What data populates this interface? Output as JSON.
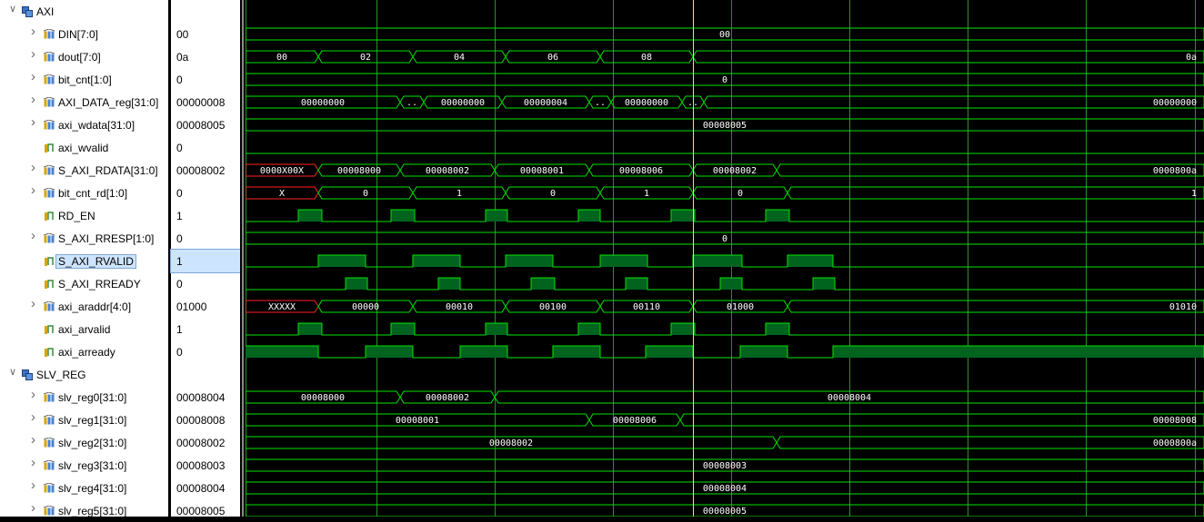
{
  "colors": {
    "bus_green": "#00e400",
    "x_red": "#ff2222",
    "fill_green": "#00641e",
    "grid": "#2c8f2c",
    "cursor": "#f4f400",
    "selected_bg": "#cde4ff"
  },
  "icons": {
    "expand": "chevron-right",
    "group": "group-folder-icon",
    "bus": "bus-signal-icon",
    "bit": "bit-signal-icon"
  },
  "signals": [
    {
      "name": "AXI",
      "value": "",
      "kind": "group",
      "expander": "down",
      "indent": 0
    },
    {
      "name": "DIN[7:0]",
      "value": "00",
      "kind": "bus",
      "expander": "right",
      "indent": 1,
      "segments": [
        {
          "t0": 0,
          "t1": 1054,
          "label": "00"
        }
      ]
    },
    {
      "name": "dout[7:0]",
      "value": "0a",
      "kind": "bus",
      "expander": "right",
      "indent": 1,
      "segments": [
        {
          "t0": 0,
          "t1": 80,
          "label": "00"
        },
        {
          "t0": 80,
          "t1": 184,
          "label": "02"
        },
        {
          "t0": 184,
          "t1": 286,
          "label": "04"
        },
        {
          "t0": 286,
          "t1": 390,
          "label": "06"
        },
        {
          "t0": 390,
          "t1": 492,
          "label": "08"
        },
        {
          "t0": 492,
          "t1": 1054,
          "label": "0a",
          "align": "right"
        }
      ]
    },
    {
      "name": "bit_cnt[1:0]",
      "value": "0",
      "kind": "bus",
      "expander": "right",
      "indent": 1,
      "segments": [
        {
          "t0": 0,
          "t1": 1054,
          "label": "0"
        }
      ]
    },
    {
      "name": "AXI_DATA_reg[31:0]",
      "value": "00000008",
      "kind": "bus",
      "expander": "right",
      "indent": 1,
      "segments": [
        {
          "t0": 0,
          "t1": 170,
          "label": "00000000"
        },
        {
          "t0": 170,
          "t1": 196,
          "label": ".."
        },
        {
          "t0": 196,
          "t1": 282,
          "label": "00000000"
        },
        {
          "t0": 282,
          "t1": 378,
          "label": "00000004"
        },
        {
          "t0": 378,
          "t1": 402,
          "label": ".."
        },
        {
          "t0": 402,
          "t1": 480,
          "label": "00000000"
        },
        {
          "t0": 480,
          "t1": 504,
          "label": ".."
        },
        {
          "t0": 504,
          "t1": 1054,
          "label": "00000000",
          "align": "right"
        }
      ]
    },
    {
      "name": "axi_wdata[31:0]",
      "value": "00008005",
      "kind": "bus",
      "expander": "right",
      "indent": 1,
      "segments": [
        {
          "t0": 0,
          "t1": 1054,
          "label": "00008005"
        }
      ]
    },
    {
      "name": "axi_wvalid",
      "value": "0",
      "kind": "bit",
      "expander": "none",
      "indent": 1,
      "edges": [
        0
      ]
    },
    {
      "name": "S_AXI_RDATA[31:0]",
      "value": "00008002",
      "kind": "bus",
      "expander": "right",
      "indent": 1,
      "segments": [
        {
          "t0": 0,
          "t1": 80,
          "label": "0000X00X",
          "x": true
        },
        {
          "t0": 80,
          "t1": 170,
          "label": "00008000"
        },
        {
          "t0": 170,
          "t1": 274,
          "label": "00008002"
        },
        {
          "t0": 274,
          "t1": 378,
          "label": "00008001"
        },
        {
          "t0": 378,
          "t1": 492,
          "label": "00008006"
        },
        {
          "t0": 492,
          "t1": 584,
          "label": "00008002"
        },
        {
          "t0": 584,
          "t1": 1054,
          "label": "0000800a",
          "align": "right"
        }
      ]
    },
    {
      "name": "bit_cnt_rd[1:0]",
      "value": "0",
      "kind": "bus",
      "expander": "right",
      "indent": 1,
      "segments": [
        {
          "t0": 0,
          "t1": 80,
          "label": "X",
          "x": true
        },
        {
          "t0": 80,
          "t1": 184,
          "label": "0"
        },
        {
          "t0": 184,
          "t1": 286,
          "label": "1"
        },
        {
          "t0": 286,
          "t1": 390,
          "label": "0"
        },
        {
          "t0": 390,
          "t1": 492,
          "label": "1"
        },
        {
          "t0": 492,
          "t1": 596,
          "label": "0"
        },
        {
          "t0": 596,
          "t1": 1054,
          "label": "1",
          "align": "right"
        }
      ]
    },
    {
      "name": "RD_EN",
      "value": "1",
      "kind": "bit",
      "expander": "none",
      "indent": 1,
      "edges": [
        0,
        58,
        84,
        160,
        186,
        264,
        288,
        366,
        390,
        468,
        494,
        572,
        598
      ]
    },
    {
      "name": "S_AXI_RRESP[1:0]",
      "value": "0",
      "kind": "bus",
      "expander": "right",
      "indent": 1,
      "segments": [
        {
          "t0": 0,
          "t1": 1054,
          "label": "0"
        }
      ]
    },
    {
      "name": "S_AXI_RVALID",
      "value": "1",
      "kind": "bit",
      "expander": "none",
      "indent": 1,
      "selected": true,
      "edges": [
        0,
        80,
        132,
        184,
        236,
        286,
        338,
        390,
        442,
        492,
        546,
        596,
        646
      ]
    },
    {
      "name": "S_AXI_RREADY",
      "value": "0",
      "kind": "bit",
      "expander": "none",
      "indent": 1,
      "edges": [
        0,
        110,
        134,
        212,
        236,
        314,
        340,
        418,
        442,
        522,
        546,
        624,
        648
      ]
    },
    {
      "name": "axi_araddr[4:0]",
      "value": "01000",
      "kind": "bus",
      "expander": "right",
      "indent": 1,
      "segments": [
        {
          "t0": 0,
          "t1": 80,
          "label": "XXXXX",
          "x": true
        },
        {
          "t0": 80,
          "t1": 184,
          "label": "00000"
        },
        {
          "t0": 184,
          "t1": 286,
          "label": "00010"
        },
        {
          "t0": 286,
          "t1": 390,
          "label": "00100"
        },
        {
          "t0": 390,
          "t1": 492,
          "label": "00110"
        },
        {
          "t0": 492,
          "t1": 596,
          "label": "01000"
        },
        {
          "t0": 596,
          "t1": 1054,
          "label": "01010",
          "align": "right"
        }
      ]
    },
    {
      "name": "axi_arvalid",
      "value": "1",
      "kind": "bit",
      "expander": "none",
      "indent": 1,
      "edges": [
        0,
        58,
        84,
        160,
        186,
        264,
        288,
        366,
        390,
        468,
        494,
        572,
        598
      ]
    },
    {
      "name": "axi_arready",
      "value": "0",
      "kind": "bit",
      "expander": "none",
      "indent": 1,
      "startHigh": true,
      "edges": [
        0,
        80,
        132,
        184,
        236,
        288,
        338,
        390,
        440,
        492,
        544,
        596,
        646,
        1054
      ]
    },
    {
      "name": "SLV_REG",
      "value": "",
      "kind": "group",
      "expander": "down",
      "indent": 0
    },
    {
      "name": "slv_reg0[31:0]",
      "value": "00008004",
      "kind": "bus",
      "expander": "right",
      "indent": 1,
      "segments": [
        {
          "t0": 0,
          "t1": 170,
          "label": "00008000"
        },
        {
          "t0": 170,
          "t1": 274,
          "label": "00008002"
        },
        {
          "t0": 274,
          "t1": 1054,
          "label": "00008004"
        }
      ]
    },
    {
      "name": "slv_reg1[31:0]",
      "value": "00008008",
      "kind": "bus",
      "expander": "right",
      "indent": 1,
      "segments": [
        {
          "t0": 0,
          "t1": 378,
          "label": "00008001"
        },
        {
          "t0": 378,
          "t1": 478,
          "label": "00008006"
        },
        {
          "t0": 478,
          "t1": 1054,
          "label": "00008008",
          "align": "right"
        }
      ]
    },
    {
      "name": "slv_reg2[31:0]",
      "value": "00008002",
      "kind": "bus",
      "expander": "right",
      "indent": 1,
      "segments": [
        {
          "t0": 0,
          "t1": 584,
          "label": "00008002"
        },
        {
          "t0": 584,
          "t1": 1054,
          "label": "0000800a",
          "align": "right"
        }
      ]
    },
    {
      "name": "slv_reg3[31:0]",
      "value": "00008003",
      "kind": "bus",
      "expander": "right",
      "indent": 1,
      "segments": [
        {
          "t0": 0,
          "t1": 1054,
          "label": "00008003"
        }
      ]
    },
    {
      "name": "slv_reg4[31:0]",
      "value": "00008004",
      "kind": "bus",
      "expander": "right",
      "indent": 1,
      "segments": [
        {
          "t0": 0,
          "t1": 1054,
          "label": "00008004"
        }
      ]
    },
    {
      "name": "slv_reg5[31:0]",
      "value": "00008005",
      "kind": "bus",
      "expander": "right",
      "indent": 1,
      "segments": [
        {
          "t0": 0,
          "t1": 1054,
          "label": "00008005"
        }
      ]
    }
  ],
  "grid_times": [
    0,
    144,
    274,
    404,
    534,
    664,
    794,
    924,
    1044
  ],
  "cursor_time": 492
}
